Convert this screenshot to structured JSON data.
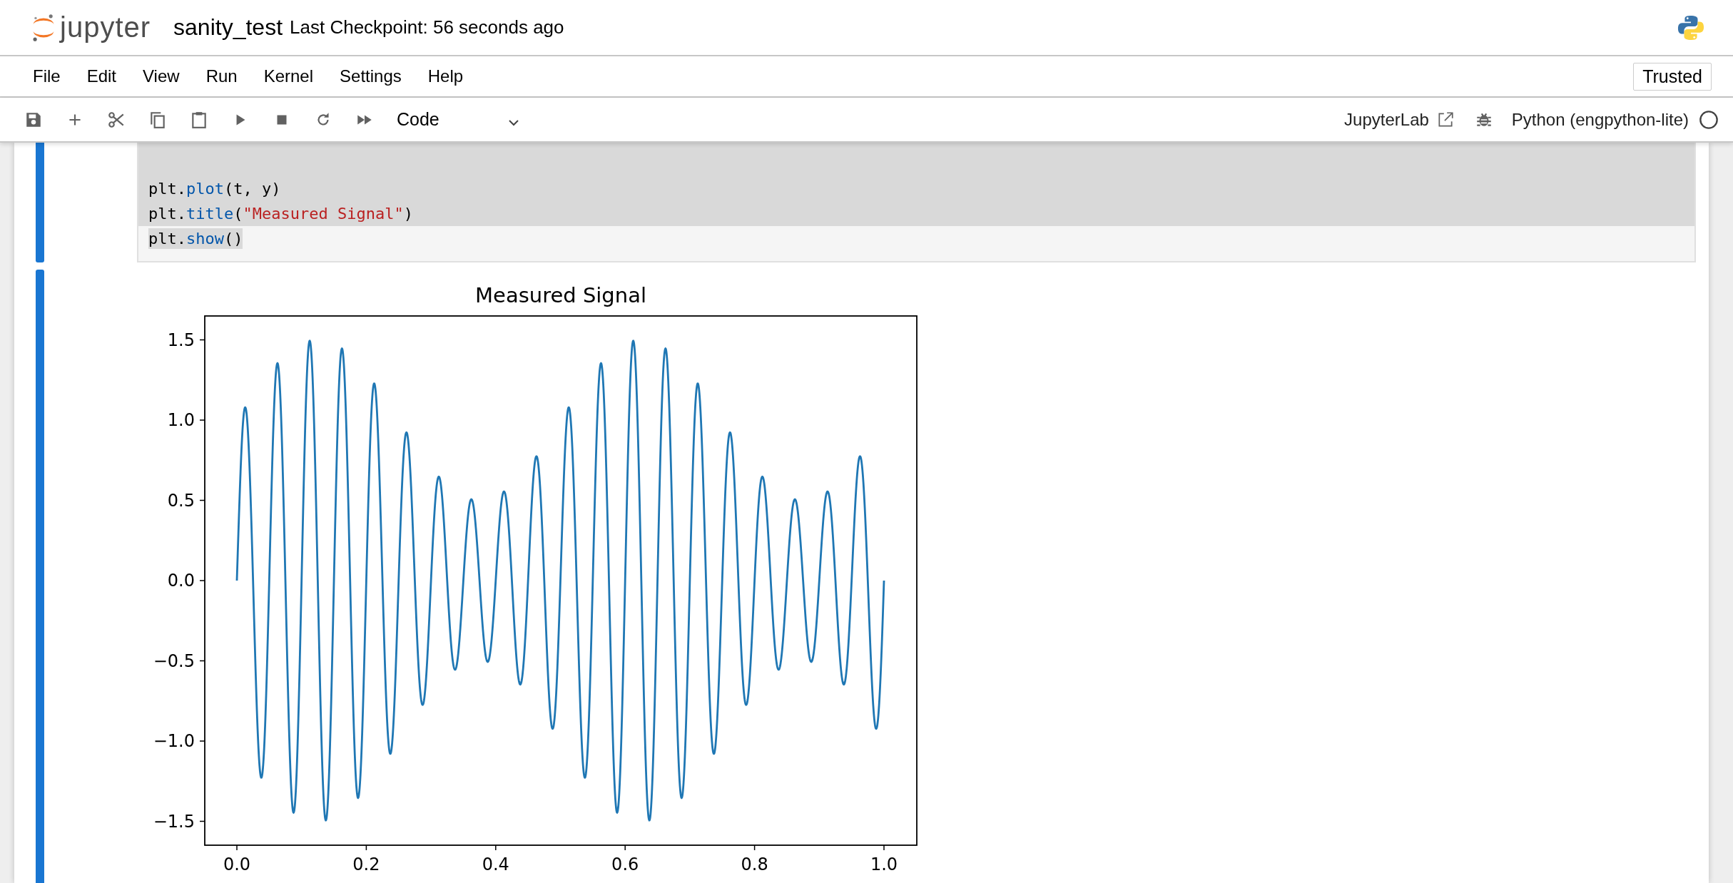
{
  "header": {
    "logo_text": "jupyter",
    "notebook_name": "sanity_test",
    "checkpoint": "Last Checkpoint: 56 seconds ago"
  },
  "menu": [
    "File",
    "Edit",
    "View",
    "Run",
    "Kernel",
    "Settings",
    "Help"
  ],
  "trusted": "Trusted",
  "toolbar": {
    "cell_type": "Code",
    "open_lab": "JupyterLab",
    "kernel": "Python (engpython-lite)",
    "kernel_busy": false
  },
  "cells": [
    {
      "kind": "code",
      "active": true,
      "lines": [
        {
          "selected": true,
          "to_line_end": true
        },
        {
          "selected": true,
          "to_line_end": true,
          "tokens": [
            {
              "kind": "plain",
              "text": "plt."
            },
            {
              "kind": "func",
              "text": "plot"
            },
            {
              "kind": "plain",
              "text": "(t, y)"
            }
          ]
        },
        {
          "selected": true,
          "to_line_end": true,
          "tokens": [
            {
              "kind": "plain",
              "text": "plt."
            },
            {
              "kind": "func",
              "text": "title"
            },
            {
              "kind": "plain",
              "text": "("
            },
            {
              "kind": "string",
              "text": "\"Measured Signal\""
            },
            {
              "kind": "plain",
              "text": ")"
            }
          ]
        },
        {
          "selected": true,
          "to_line_end": false,
          "tokens": [
            {
              "kind": "plain",
              "text": "plt."
            },
            {
              "kind": "func",
              "text": "show"
            },
            {
              "kind": "plain",
              "text": "()"
            }
          ]
        }
      ]
    },
    {
      "kind": "output",
      "active": true,
      "chart": {
        "title": "Measured Signal",
        "yticks": [
          "1.5",
          "1.0",
          "0.5",
          "0.0",
          "−0.5",
          "−1.0",
          "−1.5"
        ],
        "xticks": [
          "0.0",
          "0.2",
          "0.4",
          "0.6",
          "0.8",
          "1.0"
        ]
      }
    }
  ]
}
